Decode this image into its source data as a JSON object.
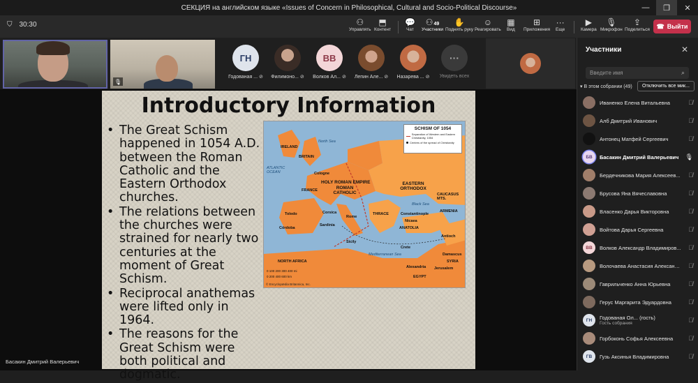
{
  "window": {
    "title": "СЕКЦИЯ на английском языке «Issues of Concern in Philosophical, Cultural and Socio-Political Discourse»"
  },
  "toolbar": {
    "timer": "30:30",
    "buttons": [
      {
        "icon": "people-icon",
        "label": "Управлять"
      },
      {
        "icon": "content-icon",
        "label": "Контент"
      },
      {
        "icon": "chat-icon",
        "label": "Чат"
      },
      {
        "icon": "participants-icon",
        "label": "Участники",
        "badge": "49"
      },
      {
        "icon": "raise-hand-icon",
        "label": "Поднять руку"
      },
      {
        "icon": "react-icon",
        "label": "Реагировать"
      },
      {
        "icon": "view-icon",
        "label": "Вид"
      },
      {
        "icon": "apps-icon",
        "label": "Приложения"
      },
      {
        "icon": "more-icon",
        "label": "Еще"
      },
      {
        "icon": "camera-icon",
        "label": "Камера"
      },
      {
        "icon": "mic-icon",
        "label": "Микрофон"
      },
      {
        "icon": "share-icon",
        "label": "Поделиться"
      }
    ],
    "leave_label": "Выйти"
  },
  "strip": {
    "tiles": [
      {
        "initials": "ГН",
        "name": "Годованая ..."
      },
      {
        "initials": "",
        "name": "Филимоно..."
      },
      {
        "initials": "ВВ",
        "name": "Волков Ал..."
      },
      {
        "initials": "",
        "name": "Лепин Але..."
      },
      {
        "initials": "",
        "name": "Назарева ..."
      },
      {
        "initials": "···",
        "name": "Увидеть всех"
      }
    ]
  },
  "slide": {
    "title": "Introductory Information",
    "bullets": [
      "The Great Schism happened in 1054 A.D. between the Roman Catholic and the Eastern Orthodox churches.",
      "The relations between the churches were strained for nearly two centuries at the moment of Great Schism.",
      "Reciprocal anathemas were lifted only in 1964.",
      "The reasons for the Great Schism were both political and dogmatic."
    ],
    "map": {
      "legend_title": "SCHISM OF 1054",
      "legend_line": "Separation of Western and Eastern Christianity, 1054",
      "legend_dot": "Centres of the spread of Christianity",
      "labels": {
        "north_sea": "North Sea",
        "ireland": "IRELAND",
        "britain": "BRITAIN",
        "atlantic": "ATLANTIC OCEAN",
        "hre": "HOLY ROMAN EMPIRE",
        "france": "FRANCE",
        "roman_catholic": "ROMAN CATHOLIC",
        "eastern_orthodox": "EASTERN ORTHODOX",
        "black_sea": "Black Sea",
        "caucasus": "CAUCASUS MTS.",
        "armenia": "ARMENIA",
        "thrace": "THRACE",
        "anatolia": "ANATOLIA",
        "north_africa": "NORTH AFRICA",
        "med": "Mediterranean Sea",
        "syria": "SYRIA",
        "egypt": "EGYPT",
        "cologne": "Cologne",
        "toledo": "Toledo",
        "cordoba": "Córdoba",
        "rome": "Rome",
        "corsica": "Corsica",
        "sardinia": "Sardinia",
        "constantinople": "Constantinople",
        "nicaea": "Nicaea",
        "antioch": "Antioch",
        "damascus": "Damascus",
        "alexandria": "Alexandria",
        "jerusalem": "Jerusalem",
        "crete": "Crete",
        "sicily": "Sicily"
      },
      "scale_label": "0    100 200 300 400 mi",
      "scale_label_km": "0    200   400   600 km",
      "credit": "© Encyclopædia Britannica, Inc."
    }
  },
  "speaker_name": "Басакин Дмитрий Валерьевич",
  "sidebar": {
    "title": "Участники",
    "search_placeholder": "Введите имя",
    "section_label": "В этом собрании (49)",
    "mute_all_label": "Отключить все мик...",
    "participants": [
      {
        "name": "Иваненко Елена Витальевна",
        "initials": "",
        "avatar_color": "#8a6f64",
        "speaking": false
      },
      {
        "name": "Алб Дмитрий Иванович",
        "initials": "",
        "avatar_color": "#6d5443",
        "speaking": false
      },
      {
        "name": "Антонец Матфей Сергеевич",
        "initials": "",
        "avatar_color": "#111111",
        "speaking": false
      },
      {
        "name": "Басакин Дмитрий Валерьевич",
        "initials": "БВ",
        "avatar_color": "#e8d7f0",
        "speaking": true
      },
      {
        "name": "Бердечникова Мария Алексеев...",
        "initials": "",
        "avatar_color": "#a07e6a",
        "speaking": false
      },
      {
        "name": "Брусова Яна Вячеславовна",
        "initials": "",
        "avatar_color": "#8c7a72",
        "speaking": false
      },
      {
        "name": "Власенко Дарья Викторовна",
        "initials": "",
        "avatar_color": "#c99a88",
        "speaking": false
      },
      {
        "name": "Войтова Дарья Сергеевна",
        "initials": "",
        "avatar_color": "#d0a093",
        "speaking": false
      },
      {
        "name": "Волков Александр Владимиров...",
        "initials": "ВВ",
        "avatar_color": "#f3d6d8",
        "speaking": false
      },
      {
        "name": "Волочаева Анастасия Александ...",
        "initials": "",
        "avatar_color": "#b89a80",
        "speaking": false
      },
      {
        "name": "Гаврильченко Анна Юрьевна",
        "initials": "",
        "avatar_color": "#9c8a78",
        "speaking": false
      },
      {
        "name": "Герус Маргарита Эдуардовна",
        "initials": "",
        "avatar_color": "#7e6a5e",
        "speaking": false
      },
      {
        "name": "Годованая Ол... (гость)",
        "sub": "Гость собрания",
        "initials": "ГН",
        "avatar_color": "#dfe4ec",
        "speaking": false
      },
      {
        "name": "Горбоконь Софья Алексеевна",
        "initials": "",
        "avatar_color": "#a88b7a",
        "speaking": false
      },
      {
        "name": "Гузь Аксинья Владимировна",
        "initials": "ГВ",
        "avatar_color": "#dfe4ec",
        "speaking": false
      }
    ]
  },
  "colors": {
    "accent": "#6264a7",
    "leave": "#c4314b",
    "catholic": "#f08a3a",
    "orthodox": "#f7a24a",
    "sea": "#8fb6d6"
  }
}
